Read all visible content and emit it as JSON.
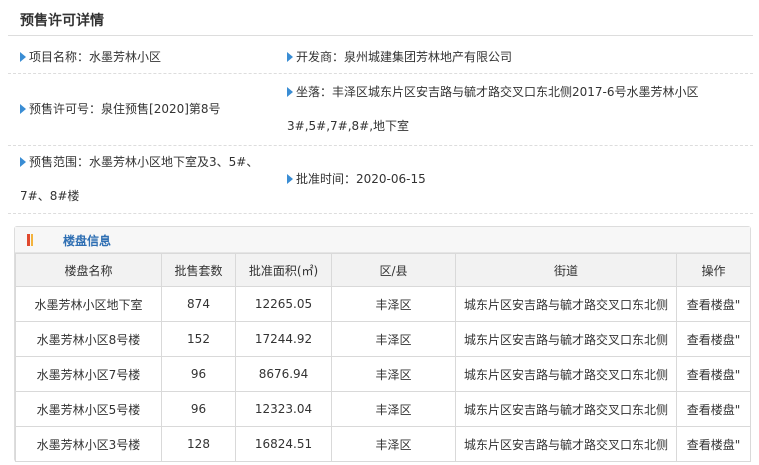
{
  "page": {
    "title": "预售许可详情"
  },
  "info": {
    "project_label": "项目名称：",
    "project_value": "水墨芳林小区",
    "developer_label": "开发商：",
    "developer_value": "泉州城建集团芳林地产有限公司",
    "permit_label": "预售许可号：",
    "permit_value": "泉住预售[2020]第8号",
    "location_label": "坐落：",
    "location_value_line1": "丰泽区城东片区安吉路与毓才路交叉口东北侧2017-6号水墨芳林小区",
    "location_value_line2": "3#,5#,7#,8#,地下室",
    "scope_label": "预售范围：",
    "scope_value_line1": "水墨芳林小区地下室及3、5#、",
    "scope_value_line2": "7#、8#楼",
    "approval_label": "批准时间：",
    "approval_value": "2020-06-15"
  },
  "building_panel": {
    "title": "楼盘信息",
    "columns": [
      "楼盘名称",
      "批售套数",
      "批准面积(㎡)",
      "区/县",
      "街道",
      "操作"
    ],
    "rows": [
      {
        "name": "水墨芳林小区地下室",
        "units": "874",
        "area": "12265.05",
        "district": "丰泽区",
        "street": "城东片区安吉路与毓才路交叉口东北侧",
        "action": "查看楼盘\""
      },
      {
        "name": "水墨芳林小区8号楼",
        "units": "152",
        "area": "17244.92",
        "district": "丰泽区",
        "street": "城东片区安吉路与毓才路交叉口东北侧",
        "action": "查看楼盘\""
      },
      {
        "name": "水墨芳林小区7号楼",
        "units": "96",
        "area": "8676.94",
        "district": "丰泽区",
        "street": "城东片区安吉路与毓才路交叉口东北侧",
        "action": "查看楼盘\""
      },
      {
        "name": "水墨芳林小区5号楼",
        "units": "96",
        "area": "12323.04",
        "district": "丰泽区",
        "street": "城东片区安吉路与毓才路交叉口东北侧",
        "action": "查看楼盘\""
      },
      {
        "name": "水墨芳林小区3号楼",
        "units": "128",
        "area": "16824.51",
        "district": "丰泽区",
        "street": "城东片区安吉路与毓才路交叉口东北侧",
        "action": "查看楼盘\""
      }
    ]
  },
  "colors": {
    "accent_blue": "#3a8dd4",
    "panel_title": "#2f6fb3",
    "marker_red": "#e0492f",
    "marker_orange": "#f3b33d"
  },
  "icons": {
    "bullet": "triangle-right-icon",
    "panel_marker": "bar-marker-icon"
  }
}
